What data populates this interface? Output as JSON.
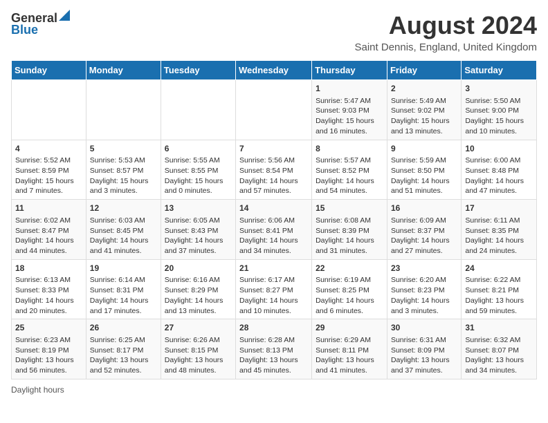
{
  "header": {
    "logo_general": "General",
    "logo_blue": "Blue",
    "main_title": "August 2024",
    "subtitle": "Saint Dennis, England, United Kingdom"
  },
  "calendar": {
    "days_of_week": [
      "Sunday",
      "Monday",
      "Tuesday",
      "Wednesday",
      "Thursday",
      "Friday",
      "Saturday"
    ],
    "weeks": [
      [
        {
          "day": "",
          "sunrise": "",
          "sunset": "",
          "daylight": ""
        },
        {
          "day": "",
          "sunrise": "",
          "sunset": "",
          "daylight": ""
        },
        {
          "day": "",
          "sunrise": "",
          "sunset": "",
          "daylight": ""
        },
        {
          "day": "",
          "sunrise": "",
          "sunset": "",
          "daylight": ""
        },
        {
          "day": "1",
          "sunrise": "Sunrise: 5:47 AM",
          "sunset": "Sunset: 9:03 PM",
          "daylight": "Daylight: 15 hours and 16 minutes."
        },
        {
          "day": "2",
          "sunrise": "Sunrise: 5:49 AM",
          "sunset": "Sunset: 9:02 PM",
          "daylight": "Daylight: 15 hours and 13 minutes."
        },
        {
          "day": "3",
          "sunrise": "Sunrise: 5:50 AM",
          "sunset": "Sunset: 9:00 PM",
          "daylight": "Daylight: 15 hours and 10 minutes."
        }
      ],
      [
        {
          "day": "4",
          "sunrise": "Sunrise: 5:52 AM",
          "sunset": "Sunset: 8:59 PM",
          "daylight": "Daylight: 15 hours and 7 minutes."
        },
        {
          "day": "5",
          "sunrise": "Sunrise: 5:53 AM",
          "sunset": "Sunset: 8:57 PM",
          "daylight": "Daylight: 15 hours and 3 minutes."
        },
        {
          "day": "6",
          "sunrise": "Sunrise: 5:55 AM",
          "sunset": "Sunset: 8:55 PM",
          "daylight": "Daylight: 15 hours and 0 minutes."
        },
        {
          "day": "7",
          "sunrise": "Sunrise: 5:56 AM",
          "sunset": "Sunset: 8:54 PM",
          "daylight": "Daylight: 14 hours and 57 minutes."
        },
        {
          "day": "8",
          "sunrise": "Sunrise: 5:57 AM",
          "sunset": "Sunset: 8:52 PM",
          "daylight": "Daylight: 14 hours and 54 minutes."
        },
        {
          "day": "9",
          "sunrise": "Sunrise: 5:59 AM",
          "sunset": "Sunset: 8:50 PM",
          "daylight": "Daylight: 14 hours and 51 minutes."
        },
        {
          "day": "10",
          "sunrise": "Sunrise: 6:00 AM",
          "sunset": "Sunset: 8:48 PM",
          "daylight": "Daylight: 14 hours and 47 minutes."
        }
      ],
      [
        {
          "day": "11",
          "sunrise": "Sunrise: 6:02 AM",
          "sunset": "Sunset: 8:47 PM",
          "daylight": "Daylight: 14 hours and 44 minutes."
        },
        {
          "day": "12",
          "sunrise": "Sunrise: 6:03 AM",
          "sunset": "Sunset: 8:45 PM",
          "daylight": "Daylight: 14 hours and 41 minutes."
        },
        {
          "day": "13",
          "sunrise": "Sunrise: 6:05 AM",
          "sunset": "Sunset: 8:43 PM",
          "daylight": "Daylight: 14 hours and 37 minutes."
        },
        {
          "day": "14",
          "sunrise": "Sunrise: 6:06 AM",
          "sunset": "Sunset: 8:41 PM",
          "daylight": "Daylight: 14 hours and 34 minutes."
        },
        {
          "day": "15",
          "sunrise": "Sunrise: 6:08 AM",
          "sunset": "Sunset: 8:39 PM",
          "daylight": "Daylight: 14 hours and 31 minutes."
        },
        {
          "day": "16",
          "sunrise": "Sunrise: 6:09 AM",
          "sunset": "Sunset: 8:37 PM",
          "daylight": "Daylight: 14 hours and 27 minutes."
        },
        {
          "day": "17",
          "sunrise": "Sunrise: 6:11 AM",
          "sunset": "Sunset: 8:35 PM",
          "daylight": "Daylight: 14 hours and 24 minutes."
        }
      ],
      [
        {
          "day": "18",
          "sunrise": "Sunrise: 6:13 AM",
          "sunset": "Sunset: 8:33 PM",
          "daylight": "Daylight: 14 hours and 20 minutes."
        },
        {
          "day": "19",
          "sunrise": "Sunrise: 6:14 AM",
          "sunset": "Sunset: 8:31 PM",
          "daylight": "Daylight: 14 hours and 17 minutes."
        },
        {
          "day": "20",
          "sunrise": "Sunrise: 6:16 AM",
          "sunset": "Sunset: 8:29 PM",
          "daylight": "Daylight: 14 hours and 13 minutes."
        },
        {
          "day": "21",
          "sunrise": "Sunrise: 6:17 AM",
          "sunset": "Sunset: 8:27 PM",
          "daylight": "Daylight: 14 hours and 10 minutes."
        },
        {
          "day": "22",
          "sunrise": "Sunrise: 6:19 AM",
          "sunset": "Sunset: 8:25 PM",
          "daylight": "Daylight: 14 hours and 6 minutes."
        },
        {
          "day": "23",
          "sunrise": "Sunrise: 6:20 AM",
          "sunset": "Sunset: 8:23 PM",
          "daylight": "Daylight: 14 hours and 3 minutes."
        },
        {
          "day": "24",
          "sunrise": "Sunrise: 6:22 AM",
          "sunset": "Sunset: 8:21 PM",
          "daylight": "Daylight: 13 hours and 59 minutes."
        }
      ],
      [
        {
          "day": "25",
          "sunrise": "Sunrise: 6:23 AM",
          "sunset": "Sunset: 8:19 PM",
          "daylight": "Daylight: 13 hours and 56 minutes."
        },
        {
          "day": "26",
          "sunrise": "Sunrise: 6:25 AM",
          "sunset": "Sunset: 8:17 PM",
          "daylight": "Daylight: 13 hours and 52 minutes."
        },
        {
          "day": "27",
          "sunrise": "Sunrise: 6:26 AM",
          "sunset": "Sunset: 8:15 PM",
          "daylight": "Daylight: 13 hours and 48 minutes."
        },
        {
          "day": "28",
          "sunrise": "Sunrise: 6:28 AM",
          "sunset": "Sunset: 8:13 PM",
          "daylight": "Daylight: 13 hours and 45 minutes."
        },
        {
          "day": "29",
          "sunrise": "Sunrise: 6:29 AM",
          "sunset": "Sunset: 8:11 PM",
          "daylight": "Daylight: 13 hours and 41 minutes."
        },
        {
          "day": "30",
          "sunrise": "Sunrise: 6:31 AM",
          "sunset": "Sunset: 8:09 PM",
          "daylight": "Daylight: 13 hours and 37 minutes."
        },
        {
          "day": "31",
          "sunrise": "Sunrise: 6:32 AM",
          "sunset": "Sunset: 8:07 PM",
          "daylight": "Daylight: 13 hours and 34 minutes."
        }
      ]
    ]
  },
  "footer": {
    "note": "Daylight hours"
  }
}
